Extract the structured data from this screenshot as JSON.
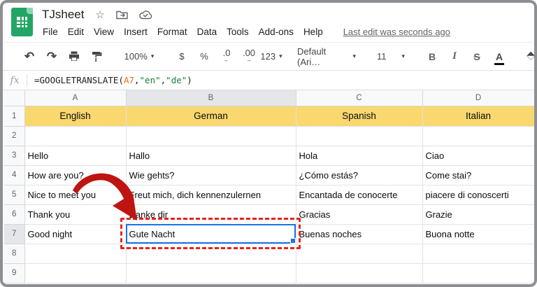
{
  "window": {
    "title": "TJsheet"
  },
  "icons": {
    "star": "☆",
    "undo": "↶",
    "redo": "↷",
    "caret": "▾"
  },
  "menu": {
    "items": [
      "File",
      "Edit",
      "View",
      "Insert",
      "Format",
      "Data",
      "Tools",
      "Add-ons",
      "Help"
    ],
    "last_edit": "Last edit was seconds ago"
  },
  "toolbar": {
    "zoom": "100%",
    "currency": "$",
    "percent": "%",
    "decrease_decimal": ".0",
    "increase_decimal": ".00",
    "more_formats": "123",
    "font": "Default (Ari…",
    "font_size": "11",
    "bold": "B",
    "italic": "I",
    "strikethrough": "S",
    "text_color": "A"
  },
  "formula_bar": {
    "fx_label": "fx",
    "full": "=GOOGLETRANSLATE(A7,\"en\",\"de\")",
    "parts": [
      {
        "t": "=GOOGLETRANSLATE(",
        "c": "default"
      },
      {
        "t": "A7",
        "c": "ref"
      },
      {
        "t": ",",
        "c": "default"
      },
      {
        "t": "\"en\"",
        "c": "string"
      },
      {
        "t": ",",
        "c": "default"
      },
      {
        "t": "\"de\"",
        "c": "string"
      },
      {
        "t": ")",
        "c": "default"
      }
    ]
  },
  "grid": {
    "column_headers": [
      "A",
      "B",
      "C",
      "D"
    ],
    "row_headers": [
      "1",
      "2",
      "3",
      "4",
      "5",
      "6",
      "7",
      "8",
      "9"
    ],
    "rows": [
      [
        "English",
        "German",
        "Spanish",
        "Italian"
      ],
      [
        "",
        "",
        "",
        ""
      ],
      [
        "Hello",
        "Hallo",
        "Hola",
        "Ciao"
      ],
      [
        "How are you?",
        "Wie gehts?",
        "¿Cómo estás?",
        "Come stai?"
      ],
      [
        "Nice to meet you",
        "Freut mich, dich kennenzulernen",
        "Encantada de conocerte",
        "piacere di conoscerti"
      ],
      [
        "Thank you",
        "Danke dir",
        "Gracias",
        "Grazie"
      ],
      [
        "Good night",
        "Gute Nacht",
        "Buenas noches",
        "Buona notte"
      ],
      [
        "",
        "",
        "",
        ""
      ],
      [
        "",
        "",
        "",
        ""
      ]
    ],
    "selection": {
      "cell": "B7",
      "column": "B",
      "row": "7",
      "value": "Gute Nacht"
    }
  },
  "colors": {
    "logo_green": "#23a566",
    "header_yellow": "#f8d86f",
    "selection_blue": "#1a73e8",
    "annotation_arrow_red": "#be1510",
    "annotation_dash_red": "#e5251c",
    "formula_ref_orange": "#e8710a",
    "formula_string_green": "#188038"
  },
  "annotations": {
    "arrow": "red curved arrow pointing from A5 to cell B7",
    "dashed_box": "red dashed rectangle highlighting cell B7"
  }
}
